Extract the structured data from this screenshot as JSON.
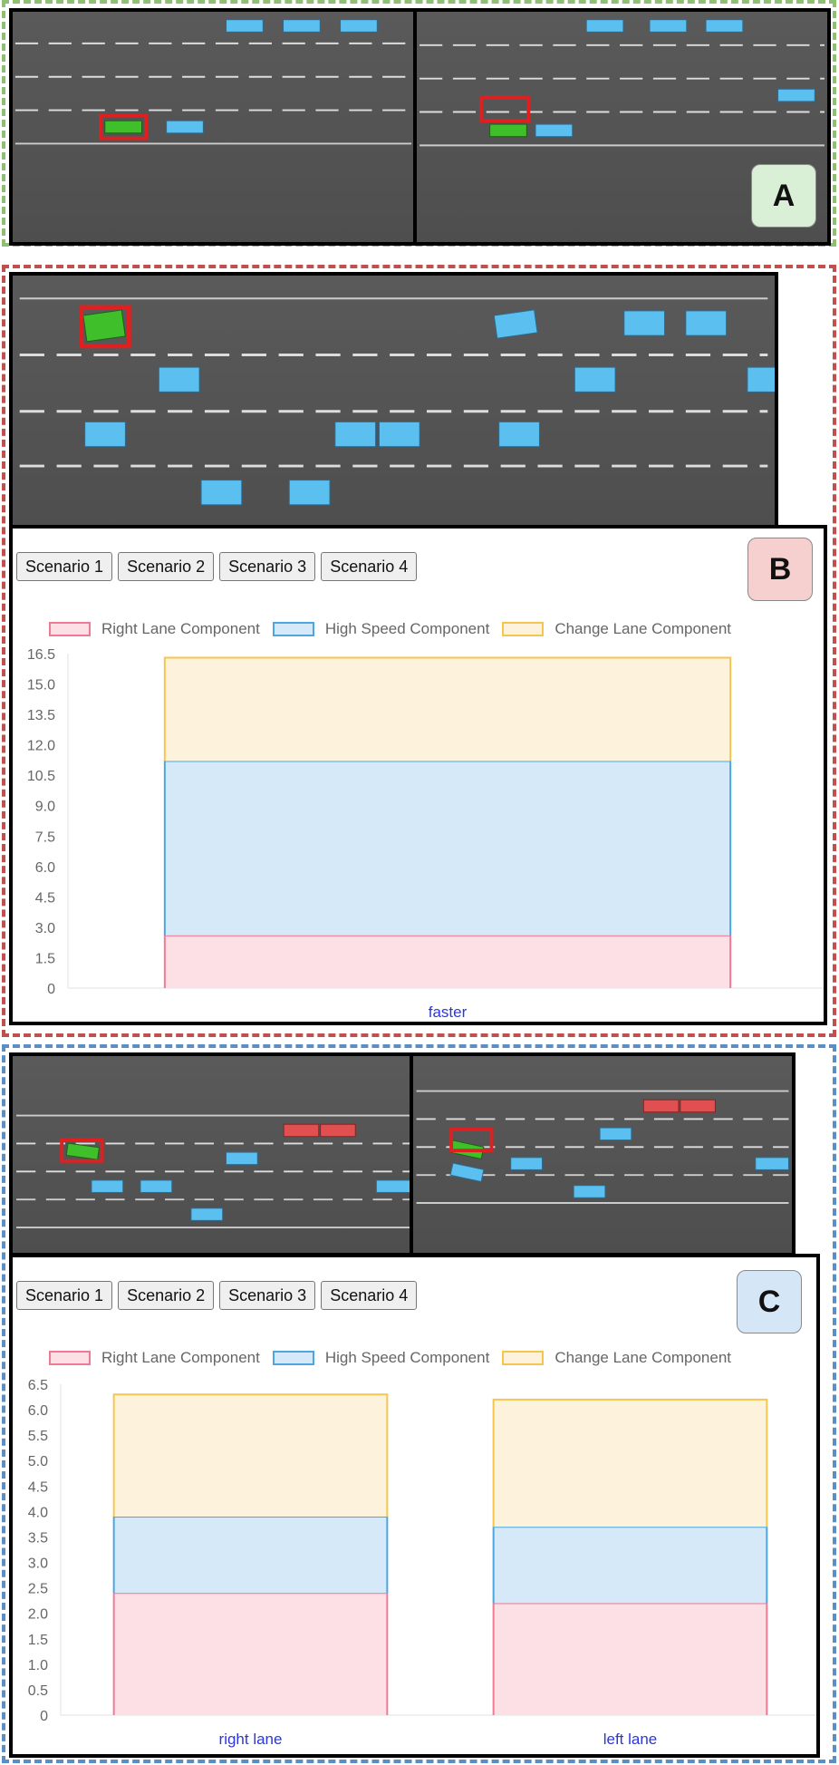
{
  "panels": {
    "A": {
      "label": "A",
      "badge_color": "#d9efd6",
      "border_color": "#8fbf72"
    },
    "B": {
      "label": "B",
      "badge_color": "#f6cfcf",
      "border_color": "#c0504d"
    },
    "C": {
      "label": "C",
      "badge_color": "#d5e6f7",
      "border_color": "#5b8ec4"
    }
  },
  "tabs": [
    "Scenario 1",
    "Scenario 2",
    "Scenario 3",
    "Scenario 4"
  ],
  "legend": [
    {
      "label": "Right Lane Component",
      "fill": "#fde0e6",
      "stroke": "#f07a94"
    },
    {
      "label": "High Speed Component",
      "fill": "#d6e9f8",
      "stroke": "#4ea6e0"
    },
    {
      "label": "Change Lane Component",
      "fill": "#fdf3dc",
      "stroke": "#f5c64e"
    }
  ],
  "chart_data": [
    {
      "type": "bar",
      "stacked": true,
      "categories": [
        "faster"
      ],
      "series": [
        {
          "name": "Right Lane Component",
          "values": [
            2.6
          ]
        },
        {
          "name": "High Speed Component",
          "values": [
            8.6
          ]
        },
        {
          "name": "Change Lane Component",
          "values": [
            5.1
          ]
        }
      ],
      "ylim": [
        0,
        16.5
      ],
      "yticks": [
        "0",
        "1.5",
        "3.0",
        "4.5",
        "6.0",
        "7.5",
        "9.0",
        "10.5",
        "12.0",
        "13.5",
        "15.0",
        "16.5"
      ],
      "grid": false,
      "legend_position": "top"
    },
    {
      "type": "bar",
      "stacked": true,
      "categories": [
        "right lane",
        "left lane"
      ],
      "series": [
        {
          "name": "Right Lane Component",
          "values": [
            2.4,
            2.2
          ]
        },
        {
          "name": "High Speed Component",
          "values": [
            1.5,
            1.5
          ]
        },
        {
          "name": "Change Lane Component",
          "values": [
            2.4,
            2.5
          ]
        }
      ],
      "ylim": [
        0,
        6.5
      ],
      "yticks": [
        "0",
        "0.5",
        "1.0",
        "1.5",
        "2.0",
        "2.5",
        "3.0",
        "3.5",
        "4.0",
        "4.5",
        "5.0",
        "5.5",
        "6.0",
        "6.5"
      ],
      "grid": false,
      "legend_position": "top"
    }
  ]
}
